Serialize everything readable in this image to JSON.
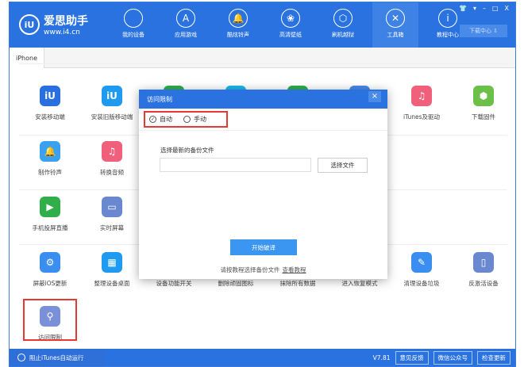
{
  "header": {
    "logo_cn": "爱思助手",
    "logo_url": "www.i4.cn",
    "download_label": "下载中心 ⇩",
    "nav": [
      {
        "label": "我的设备",
        "icon": ""
      },
      {
        "label": "应用游戏",
        "icon": "A"
      },
      {
        "label": "酷炫铃声",
        "icon": "🔔"
      },
      {
        "label": "高清壁纸",
        "icon": "❀"
      },
      {
        "label": "刷机越狱",
        "icon": "⬡"
      },
      {
        "label": "工具箱",
        "icon": "✕"
      },
      {
        "label": "教程中心",
        "icon": "i"
      }
    ],
    "window_controls": [
      "👕",
      "▾",
      "–",
      "□",
      "X"
    ]
  },
  "tabs": [
    "iPhone"
  ],
  "tools": [
    {
      "label": "安装移动端",
      "icon": "iU",
      "color": "#2a6fe0"
    },
    {
      "label": "安装旧版移动端",
      "icon": "iU",
      "color": "#1e9af0"
    },
    {
      "label": "",
      "icon": "",
      "color": "#2fae4a"
    },
    {
      "label": "",
      "icon": "",
      "color": "#1cb8e8"
    },
    {
      "label": "",
      "icon": "",
      "color": "#2fae4a"
    },
    {
      "label": "",
      "icon": "",
      "color": "#4a8ae8"
    },
    {
      "label": "iTunes及驱动",
      "icon": "♫",
      "color": "#f0607a"
    },
    {
      "label": "下载固件",
      "icon": "⬢",
      "color": "#6cc04a"
    },
    {
      "label": "制作铃声",
      "icon": "🔔",
      "color": "#3aa0f0"
    },
    {
      "label": "转换音频",
      "icon": "♫",
      "color": "#f0607a"
    },
    {
      "label": "手机投屏直播",
      "icon": "▶",
      "color": "#2fae4a"
    },
    {
      "label": "实时屏幕",
      "icon": "▭",
      "color": "#6a88d0"
    },
    {
      "label": "屏蔽iOS更新",
      "icon": "⚙",
      "color": "#3a8ef0"
    },
    {
      "label": "整理设备桌面",
      "icon": "▦",
      "color": "#1e9af0"
    },
    {
      "label": "设备功能开关",
      "icon": "",
      "color": "#fff"
    },
    {
      "label": "删除顽固图标",
      "icon": "",
      "color": "#fff"
    },
    {
      "label": "抹除所有数据",
      "icon": "",
      "color": "#fff"
    },
    {
      "label": "进入恢复模式",
      "icon": "",
      "color": "#fff"
    },
    {
      "label": "清理设备垃圾",
      "icon": "✎",
      "color": "#3a8ef0"
    },
    {
      "label": "反激活设备",
      "icon": "▯",
      "color": "#6a88d0"
    },
    {
      "label": "访问限制",
      "icon": "⚲",
      "color": "#7a90d8"
    }
  ],
  "dialog": {
    "title": "访问限制",
    "close": "×",
    "radio_auto": "自动",
    "radio_manual": "手动",
    "file_label": "选择最新的备份文件",
    "file_value": "",
    "choose_btn": "选择文件",
    "start_btn": "开始破译",
    "hint": "请按教程选择备份文件",
    "hint_link": "查看教程"
  },
  "footer": {
    "itunes_toggle": "阻止iTunes自动运行",
    "version": "V7.81",
    "feedback": "意见反馈",
    "wechat": "微信公众号",
    "update": "检查更新"
  }
}
